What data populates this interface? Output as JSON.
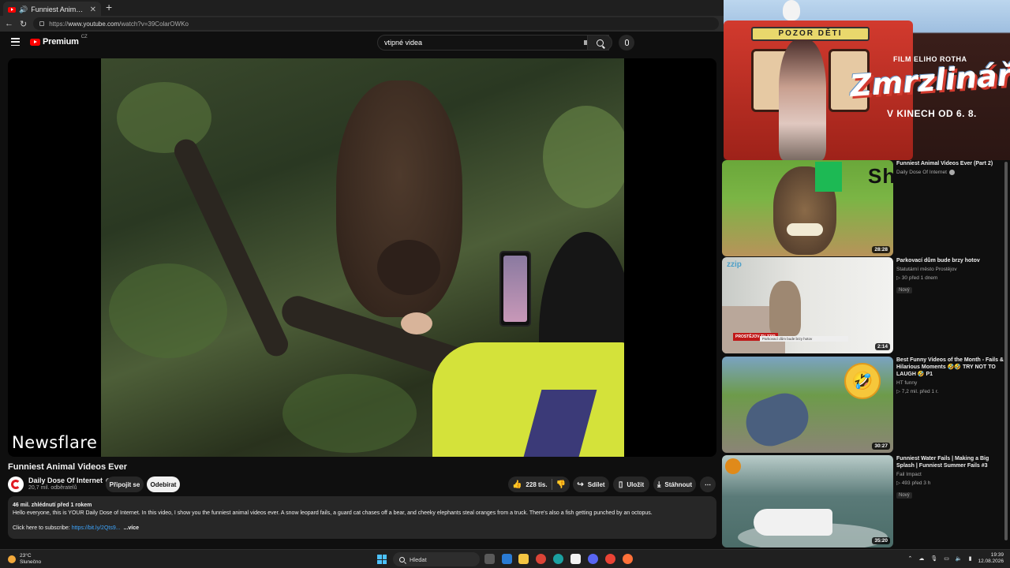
{
  "browser": {
    "tab_title": "Funniest Animal Videos Ever",
    "tab_audio_icon": "speaker-icon",
    "new_tab_label": "+",
    "url_prefix": "https://",
    "url_host": "www.youtube.com",
    "url_path": "/watch?v=39ColarOWKo"
  },
  "youtube": {
    "logo_text": "Premium",
    "logo_country": "CZ",
    "search_value": "vtipné videa",
    "accent": "#ff0000"
  },
  "video": {
    "watermark": "Newsflare",
    "title": "Funniest Animal Videos Ever",
    "channel": "Daily Dose Of Internet",
    "subscribers": "20,7 mil. odběratelů",
    "join_label": "Připojit se",
    "subscribe_label": "Odebírat",
    "likes": "228 tis.",
    "share_label": "Sdílet",
    "save_label": "Uložit",
    "download_label": "Stáhnout",
    "desc_meta": "46 mil. zhlédnutí  před 1 rokem",
    "desc_text": "Hello everyone, this is YOUR Daily Dose of Internet. In this video, I show you the funniest animal videos ever. A snow leopard fails, a guard cat chases off a bear, and cheeky elephants steal oranges from a truck. There's also a fish getting punched by an octopus.",
    "desc_sub_prefix": "Click here to subscribe: ",
    "desc_sub_link": "https://bit.ly/2Qts9...",
    "desc_more": "...více"
  },
  "ad": {
    "sign": "POZOR DĚTI",
    "film_by": "FILM ELIHO ROTHA",
    "title": "Zmrzlinář",
    "date": "V KINECH OD 6. 8."
  },
  "recommendations": [
    {
      "title": "Funniest Animal Videos Ever (Part 2)",
      "channel": "Daily Dose Of Internet",
      "views": "",
      "duration": "28:28",
      "badge": "",
      "thumb_text": "Shotvix"
    },
    {
      "title": "Parkovací dům bude brzy hotov",
      "channel": "Statutární město Prostějov",
      "views": "▷ 30   před 1 dnem",
      "duration": "2:14",
      "badge": "Nový",
      "thumb_text": "zzip",
      "thumb_lower": "PROSTĚJOV TV ZZIP",
      "thumb_lower2": "Parkovací dům bude brzy hotov"
    },
    {
      "title": "Best Funny Videos of the Month - Fails & Hilarious Moments 🤣🤣 TRY NOT TO LAUGH 🤣 P1",
      "channel": "HT funny",
      "views": "▷ 7,2 mil.   před 1 r.",
      "duration": "30:27",
      "badge": "",
      "thumb_text": "🤣"
    },
    {
      "title": "Funniest Water Fails | Making a Big Splash | Funniest Summer Fails #3",
      "channel": "Fail Impact",
      "views": "▷ 493   před 3 h",
      "duration": "35:20",
      "badge": "Nový",
      "thumb_text": ""
    }
  ],
  "taskbar": {
    "temp": "23°C",
    "weather": "Slunečno",
    "search_label": "Hledat",
    "time": "19:39",
    "date": "12.08.2026"
  }
}
